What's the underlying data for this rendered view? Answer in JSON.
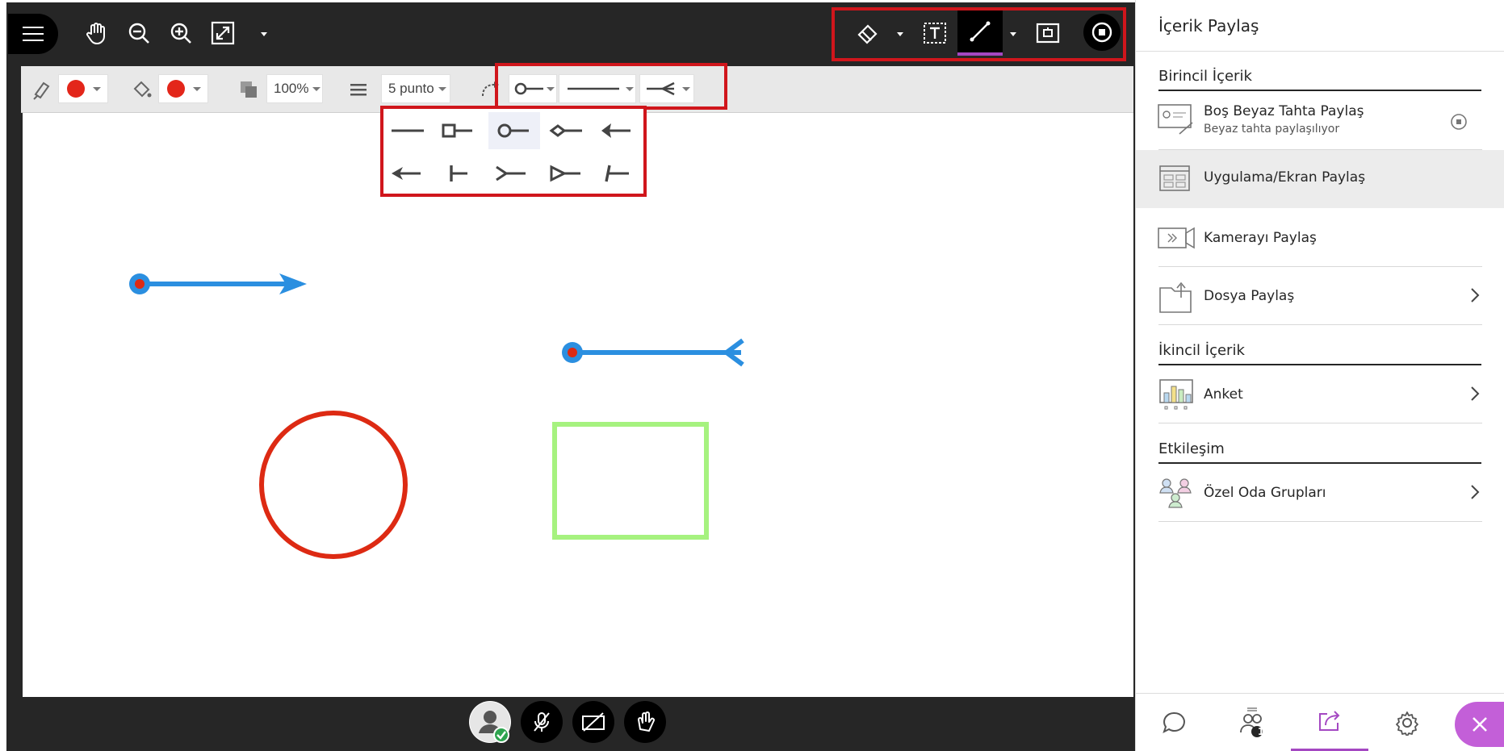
{
  "toolbar": {
    "zoom_percent": "100%",
    "line_weight": "5 punto",
    "stroke_color": "#e3261a",
    "fill_color": "#e3261a"
  },
  "line_endings": {
    "start_options": [
      "line",
      "square",
      "circle",
      "diamond",
      "arrow",
      "open-arrow",
      "bar",
      "fork",
      "triangle",
      "slash"
    ]
  },
  "canvas": {
    "shapes": [
      {
        "type": "arrow",
        "color": "#2b8fe0"
      },
      {
        "type": "fork-line",
        "color": "#2b8fe0"
      },
      {
        "type": "circle",
        "color": "#dd2a13"
      },
      {
        "type": "rectangle",
        "color": "#a6f27f"
      }
    ]
  },
  "panel": {
    "title": "İçerik Paylaş",
    "primary_head": "Birincil İçerik",
    "whiteboard_label": "Boş Beyaz Tahta Paylaş",
    "whiteboard_sub": "Beyaz tahta paylaşılıyor",
    "app_screen_label": "Uygulama/Ekran Paylaş",
    "camera_label": "Kamerayı Paylaş",
    "file_label": "Dosya Paylaş",
    "secondary_head": "İkincil İçerik",
    "poll_label": "Anket",
    "interaction_head": "Etkileşim",
    "breakout_label": "Özel Oda Grupları",
    "participants_badge": "1"
  },
  "colors": {
    "accent": "#a448c2",
    "highlight": "#d0161c",
    "dark_bar": "#262626"
  }
}
